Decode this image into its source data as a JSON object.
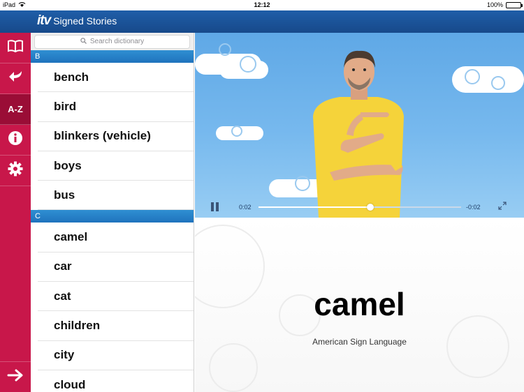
{
  "status_bar": {
    "device": "iPad",
    "time": "12:12",
    "battery": "100%",
    "battery_fraction": 1.0
  },
  "header": {
    "logo": "itv",
    "app_title": "Signed Stories"
  },
  "nav": {
    "items": [
      {
        "name": "stories",
        "icon": "book-icon"
      },
      {
        "name": "back",
        "icon": "back-arrow-icon"
      },
      {
        "name": "a-z",
        "label": "A-Z",
        "active": true
      },
      {
        "name": "info",
        "icon": "info-icon"
      },
      {
        "name": "settings",
        "icon": "gear-icon"
      }
    ],
    "bottom": {
      "icon": "arrow-right-icon"
    }
  },
  "dictionary": {
    "search_placeholder": "Search dictionary",
    "sections": [
      {
        "letter": "B",
        "words": [
          "bench",
          "bird",
          "blinkers (vehicle)",
          "boys",
          "bus"
        ]
      },
      {
        "letter": "C",
        "words": [
          "camel",
          "car",
          "cat",
          "children",
          "city",
          "cloud"
        ]
      }
    ]
  },
  "video": {
    "elapsed": "0:02",
    "remaining": "-0:02",
    "progress": 0.55,
    "buffered": 0.88,
    "state": "playing"
  },
  "word": {
    "title": "camel",
    "language": "American Sign Language"
  },
  "colors": {
    "nav": "#c8174a",
    "nav_active": "#9a0d36",
    "header": "#1f5ea8",
    "section": "#2284c9"
  }
}
